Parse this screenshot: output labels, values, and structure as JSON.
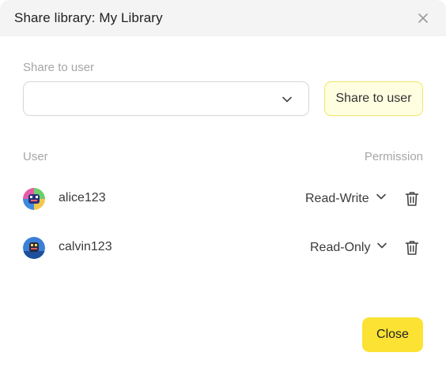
{
  "dialog": {
    "title": "Share library: My Library",
    "close_icon": "close-icon"
  },
  "share": {
    "field_label": "Share to user",
    "select_value": "",
    "button_label": "Share to user"
  },
  "table": {
    "headers": {
      "user": "User",
      "permission": "Permission"
    },
    "rows": [
      {
        "username": "alice123",
        "permission": "Read-Write",
        "avatar_icon": "avatar-icon"
      },
      {
        "username": "calvin123",
        "permission": "Read-Only",
        "avatar_icon": "avatar-icon"
      }
    ]
  },
  "footer": {
    "close_label": "Close"
  },
  "colors": {
    "accent": "#fbe233",
    "share_button_bg": "#fffee0",
    "share_button_border": "#f3e56a",
    "header_bg": "#f4f4f4"
  }
}
